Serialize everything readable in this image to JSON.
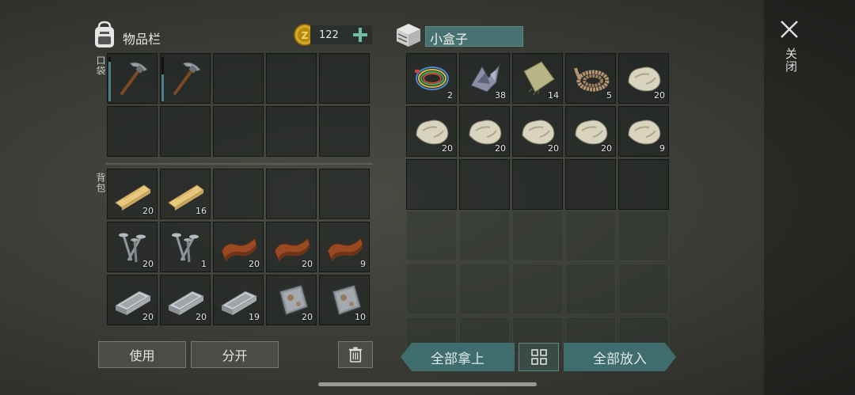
{
  "inventory": {
    "title": "物品栏",
    "coins": "122",
    "pockets_label": "口袋",
    "backpack_label": "背包",
    "pockets": [
      {
        "item": "pickaxe",
        "count": "",
        "durability": 0.9
      },
      {
        "item": "pickaxe",
        "count": "",
        "durability": 0.6
      },
      {
        "item": "",
        "count": ""
      },
      {
        "item": "",
        "count": ""
      },
      {
        "item": "",
        "count": ""
      },
      {
        "item": "",
        "count": ""
      },
      {
        "item": "",
        "count": ""
      },
      {
        "item": "",
        "count": ""
      },
      {
        "item": "",
        "count": ""
      },
      {
        "item": "",
        "count": ""
      }
    ],
    "backpack": [
      {
        "item": "wooden-plank",
        "count": "20"
      },
      {
        "item": "wooden-plank",
        "count": "16"
      },
      {
        "item": "",
        "count": ""
      },
      {
        "item": "",
        "count": ""
      },
      {
        "item": "",
        "count": ""
      },
      {
        "item": "nails",
        "count": "20"
      },
      {
        "item": "nails",
        "count": "1"
      },
      {
        "item": "leather",
        "count": "20"
      },
      {
        "item": "leather",
        "count": "20"
      },
      {
        "item": "leather",
        "count": "9"
      },
      {
        "item": "iron-bar",
        "count": "20"
      },
      {
        "item": "iron-bar",
        "count": "20"
      },
      {
        "item": "iron-bar",
        "count": "19"
      },
      {
        "item": "metal-plate",
        "count": "20"
      },
      {
        "item": "metal-plate",
        "count": "10"
      }
    ],
    "use_label": "使用",
    "split_label": "分开"
  },
  "container": {
    "title": "小盒子",
    "slots": [
      {
        "item": "wires",
        "count": "2"
      },
      {
        "item": "scrap-metal",
        "count": "38"
      },
      {
        "item": "cloth",
        "count": "14"
      },
      {
        "item": "rope",
        "count": "5"
      },
      {
        "item": "stone",
        "count": "20"
      },
      {
        "item": "stone",
        "count": "20"
      },
      {
        "item": "stone",
        "count": "20"
      },
      {
        "item": "stone",
        "count": "20"
      },
      {
        "item": "stone",
        "count": "20"
      },
      {
        "item": "stone",
        "count": "9"
      },
      {
        "item": "",
        "count": ""
      },
      {
        "item": "",
        "count": ""
      },
      {
        "item": "",
        "count": ""
      },
      {
        "item": "",
        "count": ""
      },
      {
        "item": "",
        "count": ""
      }
    ],
    "take_all_label": "全部拿上",
    "put_all_label": "全部放入"
  },
  "close_label": "关闭",
  "colors": {
    "accent": "#3f6c6c",
    "title_field": "#467272",
    "coin": "#d4a821"
  }
}
